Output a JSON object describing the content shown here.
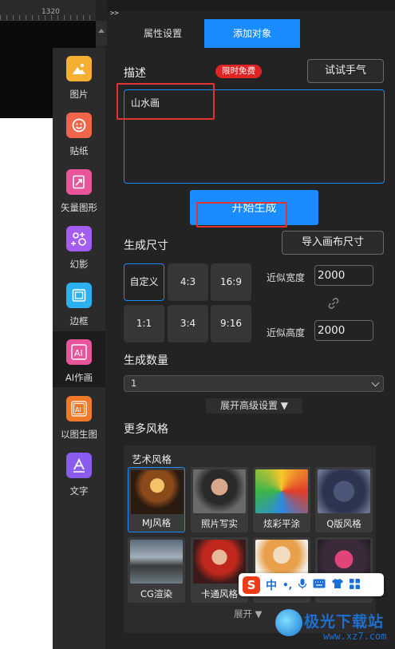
{
  "ruler": {
    "marker": "1320"
  },
  "window": {
    "collapse_label": ">>"
  },
  "tabs": [
    {
      "label": "属性设置"
    },
    {
      "label": "添加对象"
    }
  ],
  "sidebar": {
    "items": [
      {
        "label": "图片",
        "icon": "image-icon",
        "color": "#f5b033"
      },
      {
        "label": "贴纸",
        "icon": "sticker-icon",
        "color": "#f0654a"
      },
      {
        "label": "矢量图形",
        "icon": "vector-icon",
        "color": "#e8559a"
      },
      {
        "label": "幻影",
        "icon": "phantom-icon",
        "color": "#a35df2"
      },
      {
        "label": "边框",
        "icon": "frame-icon",
        "color": "#2bb0f0"
      },
      {
        "label": "AI作画",
        "icon": "ai-paint-icon",
        "color": "#e8559a"
      },
      {
        "label": "以图生图",
        "icon": "image-to-image-icon",
        "color": "#f07a2a"
      },
      {
        "label": "文字",
        "icon": "text-icon",
        "color": "#8a5cf0"
      }
    ],
    "active": "AI作画"
  },
  "describe": {
    "title": "描述",
    "badge": "限时免费",
    "try_button": "试试手气",
    "value": "山水画",
    "generate_button": "开始生成"
  },
  "size": {
    "title": "生成尺寸",
    "import_button": "导入画布尺寸",
    "ratios": [
      "自定义",
      "4:3",
      "16:9",
      "1:1",
      "3:4",
      "9:16"
    ],
    "selected": "自定义",
    "width_label": "近似宽度",
    "width_value": "2000",
    "height_label": "近似高度",
    "height_value": "2000"
  },
  "count": {
    "title": "生成数量",
    "value": "1",
    "advanced": "展开高级设置 ▼"
  },
  "styles": {
    "title": "更多风格",
    "category": "艺术风格",
    "items": [
      "MJ风格",
      "照片写实",
      "炫彩平涂",
      "Q版风格",
      "CG渲染",
      "卡通风格",
      "",
      ""
    ],
    "selected": "MJ风格",
    "expand": "展开 ▼"
  },
  "ime": {
    "logo": "S",
    "mode": "中",
    "punct": "•,"
  },
  "watermark": {
    "brand": "极光下载站",
    "url": "www.xz7.com"
  }
}
